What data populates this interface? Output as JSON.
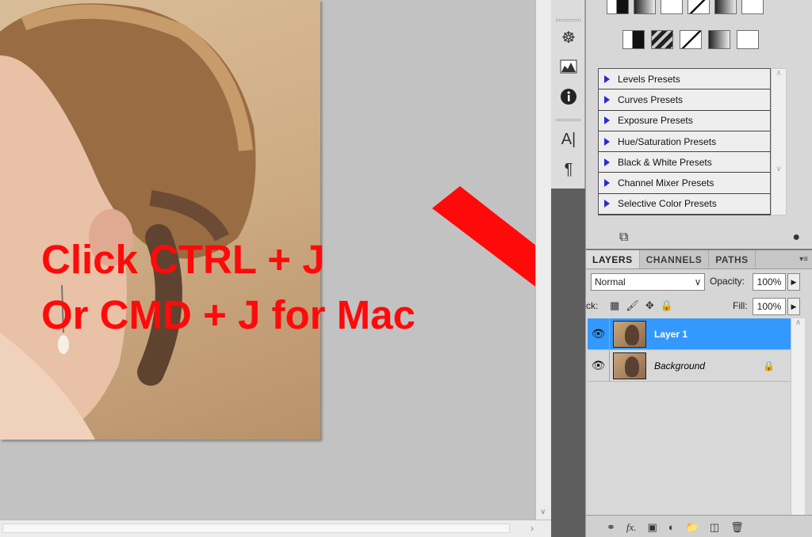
{
  "overlay": {
    "line1": "Click CTRL + J",
    "line2": "Or CMD + J for Mac"
  },
  "adjustment_presets": [
    "Levels Presets",
    "Curves Presets",
    "Exposure Presets",
    "Hue/Saturation Presets",
    "Black & White Presets",
    "Channel Mixer Presets",
    "Selective Color Presets"
  ],
  "tabs": {
    "layers": "LAYERS",
    "channels": "CHANNELS",
    "paths": "PATHS"
  },
  "layers_panel": {
    "blend_mode": "Normal",
    "opacity_label": "Opacity:",
    "opacity_value": "100%",
    "lock_label": "ck:",
    "fill_label": "Fill:",
    "fill_value": "100%"
  },
  "layers": [
    {
      "name": "Layer 1",
      "selected": true
    },
    {
      "name": "Background",
      "selected": false,
      "locked": true
    }
  ],
  "colors": {
    "annotation_red": "#ff0a0a",
    "selection_blue": "#3399ff"
  },
  "icons": {
    "dock": [
      "wheel-icon",
      "histogram-icon",
      "info-icon",
      "character-icon",
      "paragraph-icon"
    ],
    "footer": [
      "link-icon",
      "fx-icon",
      "mask-icon",
      "adjustment-icon",
      "group-icon",
      "new-layer-icon",
      "trash-icon"
    ]
  }
}
